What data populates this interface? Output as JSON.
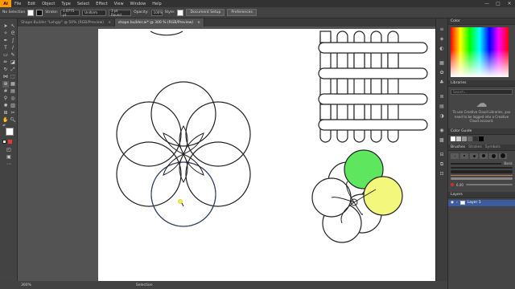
{
  "app": {
    "logo": "Ai"
  },
  "menu": [
    "File",
    "Edit",
    "Object",
    "Type",
    "Select",
    "Effect",
    "View",
    "Window",
    "Help"
  ],
  "window_buttons": [
    "—",
    "□",
    "✕"
  ],
  "control": {
    "selection": "No Selection",
    "stroke_label": "Stroke:",
    "stroke_value": "1.0775 pt",
    "profile_label": "Uniform",
    "brush_value": "3 pt. Round",
    "opacity_label": "Opacity:",
    "opacity_value": "100%",
    "style_label": "Style:",
    "doc_setup": "Document Setup",
    "preferences": "Preferences"
  },
  "tabs": [
    {
      "label": "Shape Builder \"Lehgip\" @ 50% (RGB/Preview)",
      "active": false
    },
    {
      "label": "shape builder.ai* @ 300 % (RGB/Preview)",
      "active": true
    }
  ],
  "tab_close": "×",
  "status": {
    "zoom": "300%",
    "tool": "Selection"
  },
  "panels": {
    "color": {
      "title": "Color"
    },
    "libraries": {
      "title": "Libraries",
      "search_placeholder": "Search...",
      "message": "To use Creative Cloud Libraries, you need to be logged into a Creative Cloud account."
    },
    "color_guide": {
      "title": "Color Guide"
    },
    "brushes": {
      "tabs": [
        "Brushes",
        "Strokes",
        "Symbols"
      ],
      "basic_label": "Basic",
      "size_label": "6.00"
    },
    "layers": {
      "title": "Layers",
      "layer_name": "Layer 1"
    }
  },
  "colors": {
    "green": "#5ee75e",
    "yellow": "#f3f77c",
    "accent": "#ff9a00"
  }
}
